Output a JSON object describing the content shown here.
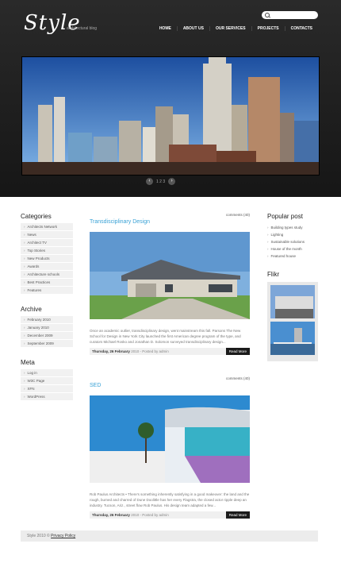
{
  "site": {
    "logo": "Style",
    "tagline": "architectural blog"
  },
  "nav": [
    "HOME",
    "ABOUT US",
    "OUR SERVICES",
    "PROJECTS",
    "CONTACTS"
  ],
  "slider": {
    "pager": "1 2 3"
  },
  "categories": {
    "title": "Categories",
    "items": [
      "Architects Network",
      "News",
      "Architect TV",
      "Top Stories",
      "New Products",
      "Awards",
      "Architecture schools",
      "Best Practices",
      "Features"
    ]
  },
  "archive": {
    "title": "Archive",
    "items": [
      "February 2010",
      "January 2010",
      "December 2009",
      "September 2009"
    ]
  },
  "meta": {
    "title": "Meta",
    "items": [
      "Log in",
      "W3C Page",
      "XFN",
      "WordPress"
    ]
  },
  "posts": [
    {
      "title": "Transdisciplinary Design",
      "comments": "comments (40)",
      "text": "Once an academic outlier, transdisciplinary design, went mainstream this fall. Parsons The New School for Design in New York City launched the first American degree program of the type, and curators Michael Rosko and Jonathan D. Solomon surveyed transdisciplinary design...",
      "date": "Thursday, 26 February",
      "info": "2010 - Posted by admin",
      "read_more": "Read More"
    },
    {
      "title": "SED",
      "comments": "comments (40)",
      "text": "Rob Paulus Architects • There's something inherently satisfying in a good makeover: the land and the rough, burned and charred of Dune Doolittle has her every Flagstra, the closed actor ripple deep an industry. Tucson, Ariz., street flow Rob Paulus. His design team adapted a few...",
      "date": "Thursday, 26 February",
      "info": "2010 - Posted by admin",
      "read_more": "Read More"
    }
  ],
  "popular": {
    "title": "Popular post",
    "items": [
      "Building types study",
      "Lighting",
      "Sustainable solutions",
      "House of the month",
      "Featured house"
    ]
  },
  "flikr": {
    "title": "Flikr"
  },
  "footer": {
    "text": "Style 2010 ©",
    "link": "Privacy Policy"
  }
}
